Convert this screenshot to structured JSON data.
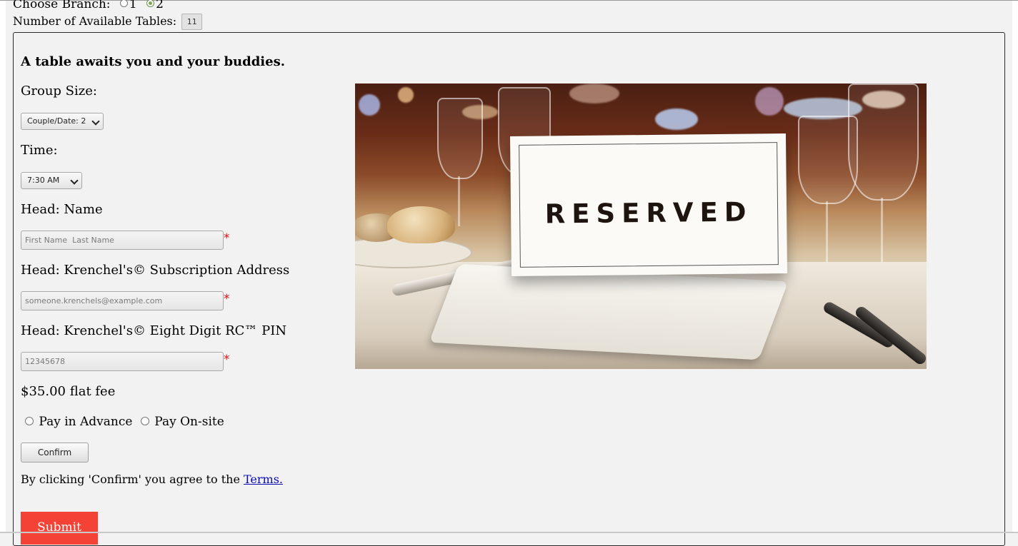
{
  "branch": {
    "label": "Choose Branch:",
    "options": [
      "1",
      "2"
    ],
    "selected": "2"
  },
  "tables": {
    "label": "Number of Available Tables:",
    "count": "11"
  },
  "form": {
    "heading": "A table awaits you and your buddies.",
    "group_size_label": "Group Size:",
    "group_size_value": "Couple/Date: 2",
    "time_label": "Time:",
    "time_value": "7:30 AM",
    "name_label": "Head: Name",
    "name_placeholder": "First Name  Last Name",
    "address_label": "Head: Krenchel's© Subscription Address",
    "address_placeholder": "someone.krenchels@example.com",
    "pin_label": "Head: Krenchel's© Eight Digit RC™ PIN",
    "pin_placeholder": "12345678",
    "required_marker": "*",
    "fee": "$35.00 flat fee",
    "pay_advance_label": "Pay in Advance",
    "pay_onsite_label": "Pay On-site",
    "confirm_label": "Confirm",
    "terms_text": "By clicking 'Confirm' you agree to the ",
    "terms_link": "Terms.",
    "submit_label": "Submit"
  },
  "photo": {
    "card_text": "RESERVED"
  }
}
